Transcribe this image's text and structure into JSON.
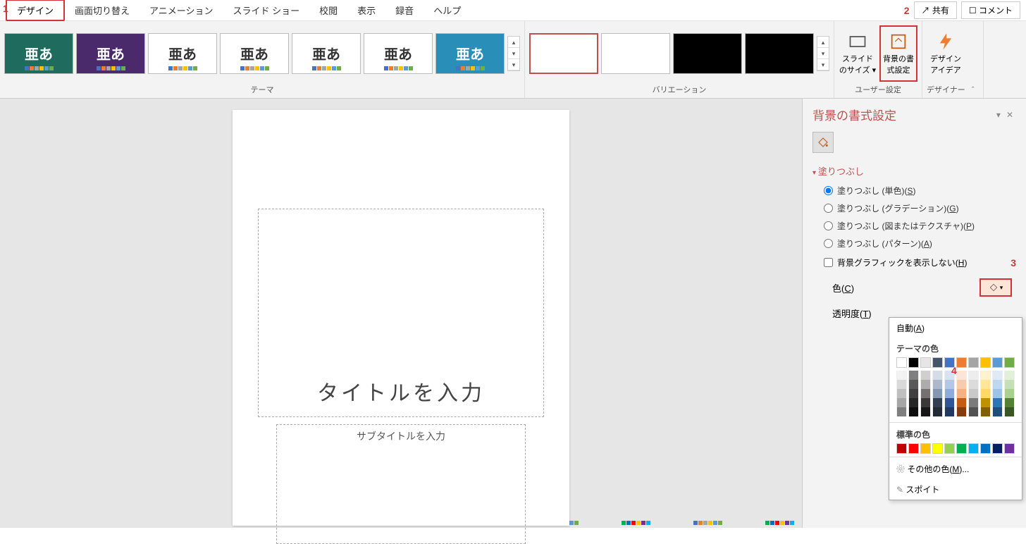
{
  "tabs": {
    "design": "デザイン",
    "transition": "画面切り替え",
    "animation": "アニメーション",
    "slideshow": "スライド ショー",
    "review": "校閲",
    "view": "表示",
    "record": "録音",
    "help": "ヘルプ"
  },
  "topright": {
    "share": "共有",
    "comment": "コメント"
  },
  "ribbon": {
    "themes_label": "テーマ",
    "variations_label": "バリエーション",
    "usersettings_label": "ユーザー設定",
    "designer_label": "デザイナー",
    "slide_size": "スライドのサイズ ▾",
    "format_bg": "背景の書式設定",
    "design_ideas": "デザインアイデア",
    "theme_sample": "亜あ"
  },
  "annotations": {
    "n1": "1",
    "n2": "2",
    "n3": "3",
    "n4": "4"
  },
  "slide": {
    "title": "タイトルを入力",
    "subtitle": "サブタイトルを入力"
  },
  "pane": {
    "title": "背景の書式設定",
    "section_fill": "塗りつぶし",
    "fill_solid_pre": "塗りつぶし (単色)(",
    "fill_solid_u": "S",
    "fill_grad_pre": "塗りつぶし (グラデーション)(",
    "fill_grad_u": "G",
    "fill_pic_pre": "塗りつぶし (図またはテクスチャ)(",
    "fill_pic_u": "P",
    "fill_pat_pre": "塗りつぶし (パターン)(",
    "fill_pat_u": "A",
    "paren_close": ")",
    "hide_bg_pre": "背景グラフィックを表示しない(",
    "hide_bg_u": "H",
    "color_label_pre": "色(",
    "color_label_u": "C",
    "transparency_pre": "透明度(",
    "transparency_u": "T"
  },
  "popup": {
    "auto_pre": "自動(",
    "auto_u": "A",
    "theme_colors": "テーマの色",
    "standard_colors": "標準の色",
    "more_colors_pre": "その他の色(",
    "more_colors_u": "M",
    "more_colors_post": ")...",
    "eyedropper": "スポイト",
    "theme_row": [
      "#ffffff",
      "#000000",
      "#e7e6e6",
      "#44546a",
      "#4472c4",
      "#ed7d31",
      "#a5a5a5",
      "#ffc000",
      "#5b9bd5",
      "#70ad47"
    ],
    "shades": [
      [
        "#f2f2f2",
        "#d9d9d9",
        "#bfbfbf",
        "#a6a6a6",
        "#7f7f7f"
      ],
      [
        "#7f7f7f",
        "#595959",
        "#404040",
        "#262626",
        "#0d0d0d"
      ],
      [
        "#d0cece",
        "#aeabab",
        "#767171",
        "#3b3838",
        "#181717"
      ],
      [
        "#d6dce5",
        "#adb9ca",
        "#8497b0",
        "#333f50",
        "#222a35"
      ],
      [
        "#d9e2f3",
        "#b4c7e7",
        "#8faadc",
        "#2f5597",
        "#203864"
      ],
      [
        "#fbe5d6",
        "#f7cbac",
        "#f4b183",
        "#c55a11",
        "#843c0c"
      ],
      [
        "#ededed",
        "#dbdbdb",
        "#c9c9c9",
        "#7b7b7b",
        "#525252"
      ],
      [
        "#fff2cc",
        "#ffe699",
        "#ffd966",
        "#bf9000",
        "#806000"
      ],
      [
        "#deebf7",
        "#bdd7ee",
        "#9dc3e6",
        "#2e75b6",
        "#1f4e79"
      ],
      [
        "#e2f0d9",
        "#c5e0b4",
        "#a9d18e",
        "#548235",
        "#385723"
      ]
    ],
    "standard_row": [
      "#c00000",
      "#ff0000",
      "#ffc000",
      "#ffff00",
      "#92d050",
      "#00b050",
      "#00b0f0",
      "#0070c0",
      "#002060",
      "#7030a0"
    ]
  },
  "themes": [
    {
      "bg": "#1f6b5e",
      "fg": "#fff"
    },
    {
      "bg": "#4b2a6b",
      "fg": "#fff"
    },
    {
      "bg": "#ffffff",
      "fg": "#333",
      "pattern": true
    },
    {
      "bg": "#ffffff",
      "fg": "#333"
    },
    {
      "bg": "#ffffff",
      "fg": "#333",
      "stripe": "#f2c9a0"
    },
    {
      "bg": "#ffffff",
      "fg": "#333"
    },
    {
      "bg": "#2a8fb8",
      "fg": "#fff"
    }
  ]
}
